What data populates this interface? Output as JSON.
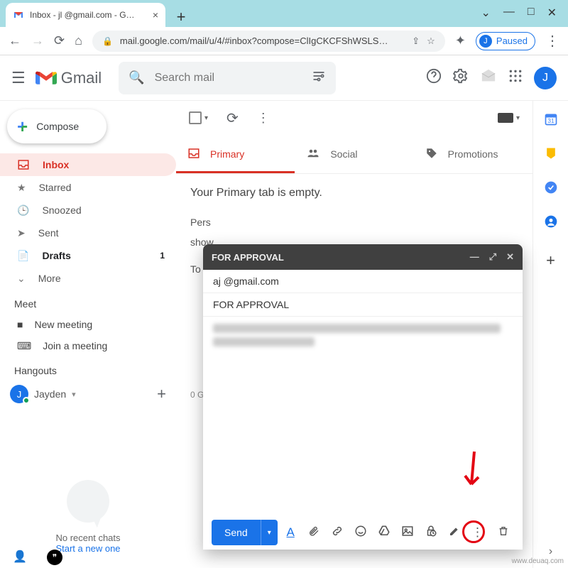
{
  "browser": {
    "tab_title": "Inbox - jl             @gmail.com - G…",
    "url": "mail.google.com/mail/u/4/#inbox?compose=ClIgCKCFShWSLS…",
    "profile_label": "Paused",
    "profile_initial": "J"
  },
  "header": {
    "logo_text": "Gmail",
    "search_placeholder": "Search mail",
    "avatar_initial": "J"
  },
  "sidebar": {
    "compose": "Compose",
    "items": [
      {
        "icon": "inbox",
        "label": "Inbox",
        "active": true
      },
      {
        "icon": "star",
        "label": "Starred"
      },
      {
        "icon": "clock",
        "label": "Snoozed"
      },
      {
        "icon": "sent",
        "label": "Sent"
      },
      {
        "icon": "draft",
        "label": "Drafts",
        "count": "1",
        "bold": true
      },
      {
        "icon": "more",
        "label": "More"
      }
    ],
    "meet_header": "Meet",
    "meet_items": [
      {
        "icon": "video",
        "label": "New meeting"
      },
      {
        "icon": "keyboard",
        "label": "Join a meeting"
      }
    ],
    "hangouts_header": "Hangouts",
    "hangouts_user": "Jayden",
    "hangouts_initial": "J",
    "no_recent": "No recent chats",
    "start_new": "Start a new one"
  },
  "content": {
    "tabs": [
      {
        "label": "Primary",
        "active": true,
        "icon": "primary"
      },
      {
        "label": "Social",
        "icon": "social"
      },
      {
        "label": "Promotions",
        "icon": "promo"
      }
    ],
    "empty": "Your Primary tab is empty.",
    "pers_line": "Pers",
    "show_line": "show",
    "to_line": "To a",
    "zero": "0 G"
  },
  "compose_win": {
    "title": "FOR APPROVAL",
    "to": "aj          @gmail.com",
    "subject": "FOR APPROVAL",
    "send": "Send"
  },
  "watermark": "www.deuaq.com"
}
